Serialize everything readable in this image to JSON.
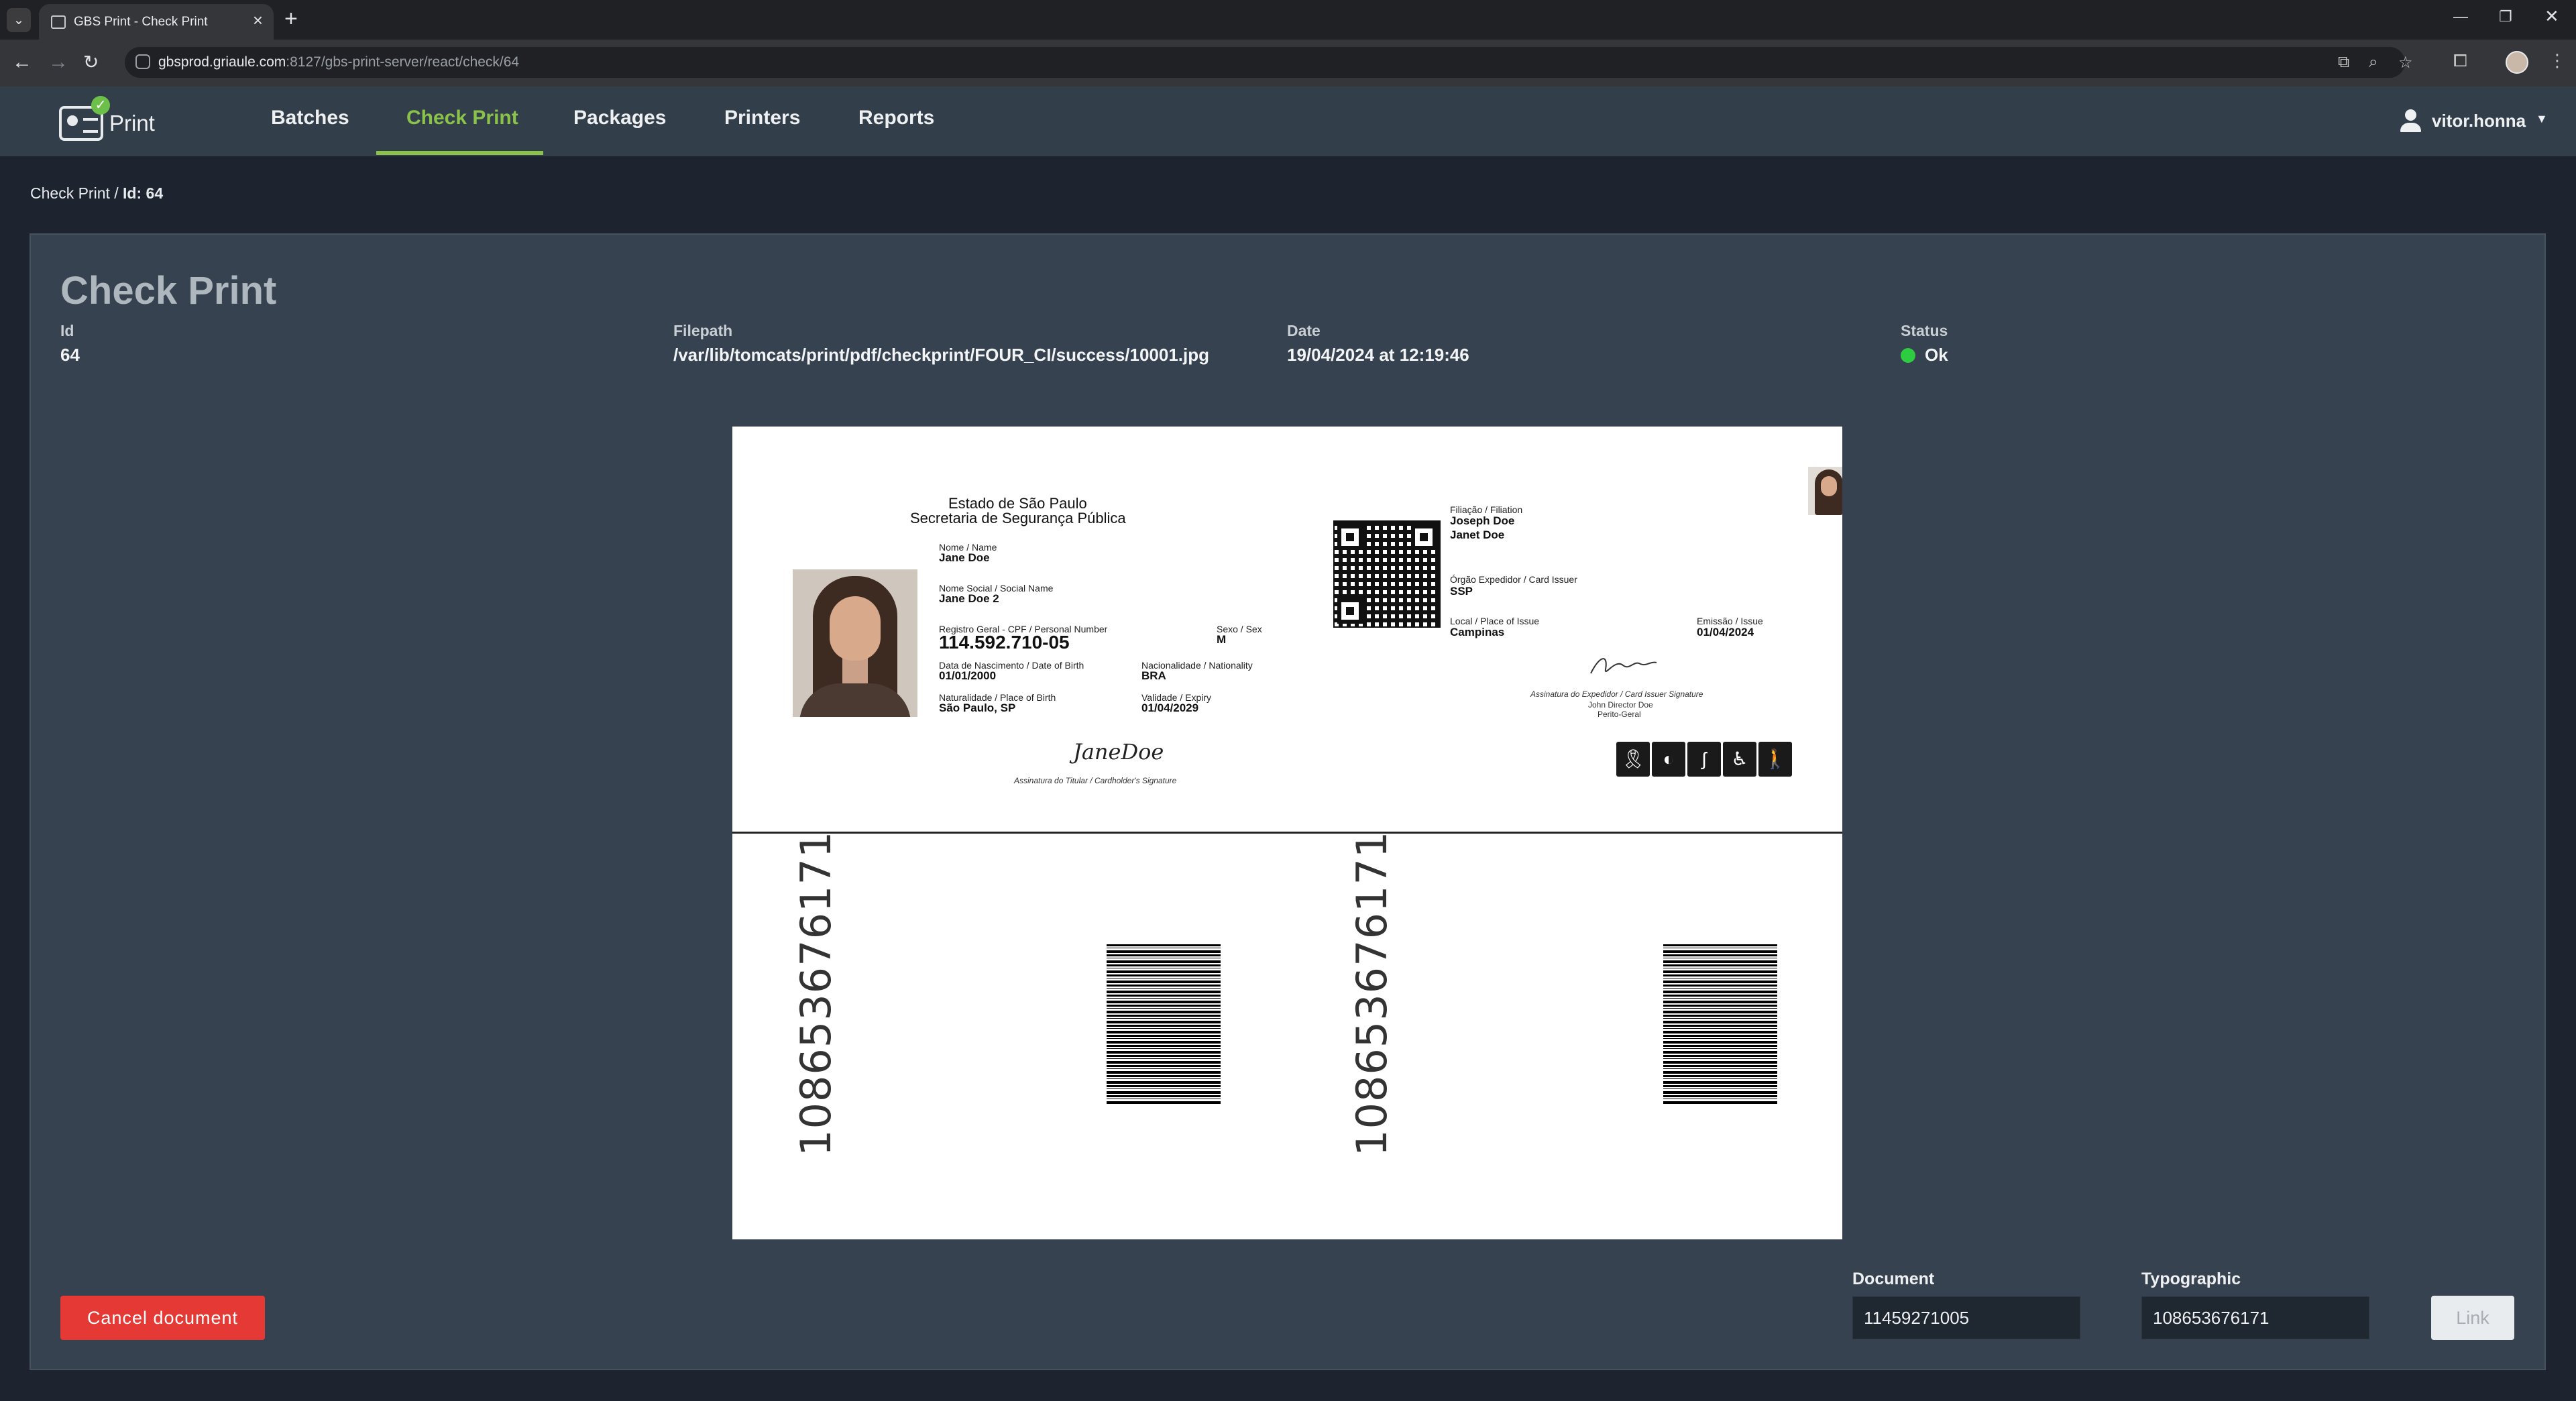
{
  "browser": {
    "tab_title": "GBS Print - Check Print",
    "url_host": "gbsprod.griaule.com",
    "url_path": ":8127/gbs-print-server/react/check/64"
  },
  "app": {
    "logo_text": "Print",
    "nav": [
      "Batches",
      "Check Print",
      "Packages",
      "Printers",
      "Reports"
    ],
    "active_nav": "Check Print",
    "user": "vitor.honna"
  },
  "breadcrumb": {
    "parent": "Check Print",
    "separator": "/",
    "current": "Id: 64"
  },
  "check": {
    "title": "Check Print",
    "id_label": "Id",
    "id_value": "64",
    "filepath_label": "Filepath",
    "filepath_value": "/var/lib/tomcats/print/pdf/checkprint/FOUR_CI/success/10001.jpg",
    "date_label": "Date",
    "date_value": "19/04/2024 at 12:19:46",
    "status_label": "Status",
    "status_value": "Ok",
    "status_color": "#2ecc40"
  },
  "card": {
    "state": "Estado de São Paulo",
    "secretariat": "Secretaria de Segurança Pública",
    "name_label": "Nome / Name",
    "name": "Jane Doe",
    "social_name_label": "Nome Social / Social Name",
    "social_name": "Jane Doe 2",
    "cpf_label": "Registro Geral - CPF / Personal Number",
    "cpf": "114.592.710-05",
    "sex_label": "Sexo / Sex",
    "sex": "M",
    "dob_label": "Data de Nascimento / Date of Birth",
    "dob": "01/01/2000",
    "nationality_label": "Nacionalidade / Nationality",
    "nationality": "BRA",
    "pob_label": "Naturalidade / Place of Birth",
    "pob": "São Paulo, SP",
    "expiry_label": "Validade / Expiry",
    "expiry": "01/04/2029",
    "holder_signature": "JaneDoe",
    "holder_signature_label": "Assinatura do Titular / Cardholder's Signature",
    "filiation_label": "Filiação / Filiation",
    "father": "Joseph Doe",
    "mother": "Janet Doe",
    "issuer_label": "Órgão Expedidor / Card Issuer",
    "issuer": "SSP",
    "place_issue_label": "Local / Place of Issue",
    "place_issue": "Campinas",
    "issue_label": "Emissão / Issue",
    "issue": "01/04/2024",
    "issuer_signature_label": "Assinatura do Expedidor / Card Issuer Signature",
    "director_name": "John Director Doe",
    "director_title": "Perito-Geral",
    "typographic_number": "108653676171",
    "accessibility_icons": [
      "ribbon-icon",
      "brain-icon",
      "hearing-icon",
      "wheelchair-icon",
      "walking-icon"
    ]
  },
  "actions": {
    "cancel_label": "Cancel document",
    "cancel_color": "#e53935",
    "document_label": "Document",
    "document_value": "11459271005",
    "typographic_label": "Typographic",
    "typographic_value": "108653676171",
    "link_label": "Link"
  }
}
